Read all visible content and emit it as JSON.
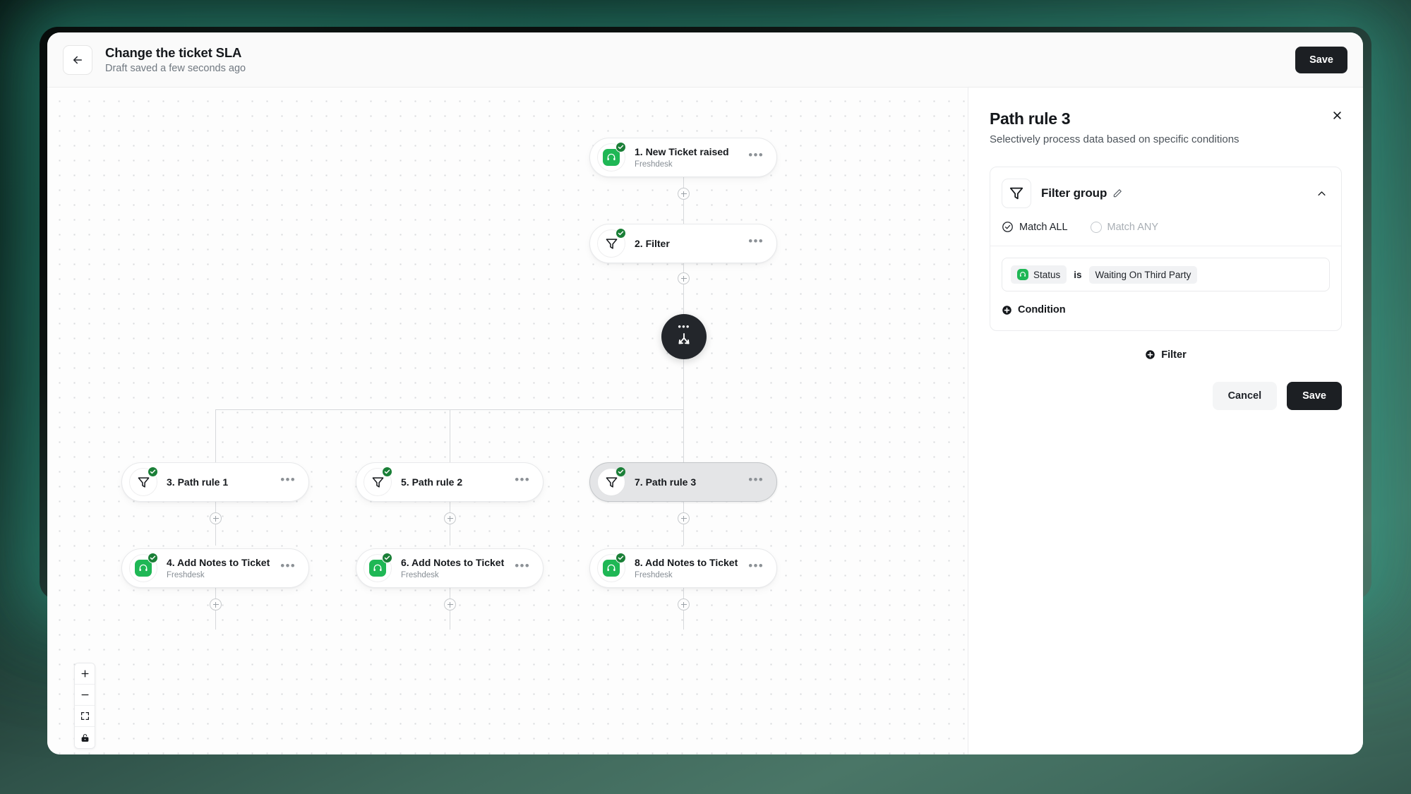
{
  "header": {
    "back_icon": "arrow-left-icon",
    "title": "Change the ticket SLA",
    "subtitle": "Draft saved a few seconds ago",
    "save_label": "Save"
  },
  "canvas": {
    "branch_node": {
      "dots": "•••",
      "icon": "branch-split-icon"
    },
    "nodes": [
      {
        "title": "1. New Ticket raised",
        "subtitle": "Freshdesk",
        "icon": "freshdesk-icon",
        "status": "check",
        "selected": false,
        "dots": "•••"
      },
      {
        "title": "2. Filter",
        "subtitle": "",
        "icon": "filter-icon",
        "status": "check",
        "selected": false,
        "dots": "•••"
      },
      {
        "title": "3. Path rule 1",
        "subtitle": "",
        "icon": "filter-icon",
        "status": "check",
        "selected": false,
        "dots": "•••"
      },
      {
        "title": "4. Add Notes to Ticket",
        "subtitle": "Freshdesk",
        "icon": "freshdesk-icon",
        "status": "check",
        "selected": false,
        "dots": "•••"
      },
      {
        "title": "5. Path rule 2",
        "subtitle": "",
        "icon": "filter-icon",
        "status": "check",
        "selected": false,
        "dots": "•••"
      },
      {
        "title": "6. Add Notes to Ticket",
        "subtitle": "Freshdesk",
        "icon": "freshdesk-icon",
        "status": "check",
        "selected": false,
        "dots": "•••"
      },
      {
        "title": "7. Path rule 3",
        "subtitle": "",
        "icon": "filter-icon",
        "status": "check",
        "selected": true,
        "dots": "•••"
      },
      {
        "title": "8. Add Notes to Ticket",
        "subtitle": "Freshdesk",
        "icon": "freshdesk-icon",
        "status": "check",
        "selected": false,
        "dots": "•••"
      }
    ],
    "zoom_controls": [
      {
        "name": "zoom-in-icon"
      },
      {
        "name": "zoom-out-icon"
      },
      {
        "name": "fit-to-screen-icon"
      },
      {
        "name": "lock-icon"
      }
    ]
  },
  "panel": {
    "title": "Path rule 3",
    "subtitle": "Selectively process data based on specific conditions",
    "close_icon": "close-icon",
    "filter_group": {
      "icon": "filter-icon",
      "title": "Filter group",
      "edit_icon": "pencil-icon",
      "collapse_icon": "chevron-up-icon",
      "match_all_label": "Match ALL",
      "match_any_label": "Match ANY",
      "match_selected": "Match ALL",
      "conditions": [
        {
          "field": "Status",
          "field_icon": "freshdesk-icon",
          "operator": "is",
          "value": "Waiting On Third Party"
        }
      ],
      "add_condition_label": "Condition"
    },
    "add_filter_label": "Filter",
    "cancel_label": "Cancel",
    "save_label": "Save"
  },
  "colors": {
    "accent_green": "#1fb755",
    "check_green": "#1a7f37",
    "dark": "#1c1f23",
    "selected_node": "#e4e5e7"
  }
}
